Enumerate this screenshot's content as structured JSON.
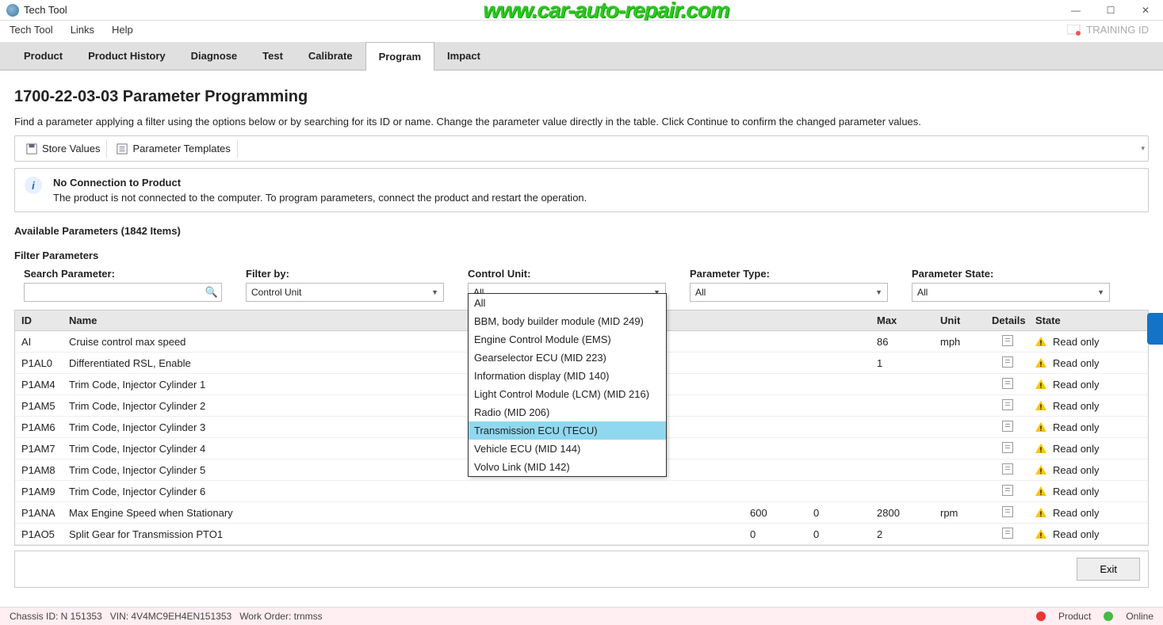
{
  "window": {
    "title": "Tech Tool"
  },
  "watermark": "www.car-auto-repair.com",
  "training_id": "TRAINING ID",
  "menubar": {
    "items": [
      "Tech Tool",
      "Links",
      "Help"
    ]
  },
  "tabs": {
    "items": [
      "Product",
      "Product History",
      "Diagnose",
      "Test",
      "Calibrate",
      "Program",
      "Impact"
    ],
    "active_index": 5
  },
  "page": {
    "title": "1700-22-03-03 Parameter Programming",
    "description": "Find a parameter applying a filter using the options below or by searching for its ID or name. Change the parameter value directly in the table. Click Continue to confirm the changed parameter values."
  },
  "toolbar": {
    "store_values": "Store Values",
    "templates": "Parameter Templates"
  },
  "infobox": {
    "title": "No Connection to Product",
    "text": "The product is not connected to the computer. To program parameters, connect the product and restart the operation."
  },
  "available_label": "Available Parameters (1842 Items)",
  "filter_label": "Filter Parameters",
  "filters": {
    "search_label": "Search Parameter:",
    "filterby_label": "Filter by:",
    "filterby_value": "Control Unit",
    "control_unit_label": "Control Unit:",
    "control_unit_value": "All",
    "param_type_label": "Parameter Type:",
    "param_type_value": "All",
    "param_state_label": "Parameter State:",
    "param_state_value": "All"
  },
  "control_unit_options": [
    "All",
    "BBM, body builder module (MID 249)",
    "Engine Control Module (EMS)",
    "Gearselector ECU (MID 223)",
    "Information display (MID 140)",
    "Light Control Module (LCM) (MID 216)",
    "Radio (MID 206)",
    "Transmission ECU (TECU)",
    "Vehicle ECU (MID 144)",
    "Volvo Link (MID 142)"
  ],
  "control_unit_highlight_index": 7,
  "columns": {
    "id": "ID",
    "name": "Name",
    "value": "",
    "min": "",
    "max": "Max",
    "unit": "Unit",
    "details": "Details",
    "state": "State"
  },
  "rows": [
    {
      "id": "AI",
      "name": "Cruise control max speed",
      "value": "",
      "min": "",
      "max": "86",
      "unit": "mph",
      "state": "Read only"
    },
    {
      "id": "P1AL0",
      "name": "Differentiated RSL, Enable",
      "value": "",
      "min": "",
      "max": "1",
      "unit": "",
      "state": "Read only"
    },
    {
      "id": "P1AM4",
      "name": "Trim Code, Injector Cylinder 1",
      "value": "",
      "min": "",
      "max": "",
      "unit": "",
      "state": "Read only"
    },
    {
      "id": "P1AM5",
      "name": "Trim Code, Injector Cylinder 2",
      "value": "",
      "min": "",
      "max": "",
      "unit": "",
      "state": "Read only"
    },
    {
      "id": "P1AM6",
      "name": "Trim Code, Injector Cylinder 3",
      "value": "",
      "min": "",
      "max": "",
      "unit": "",
      "state": "Read only"
    },
    {
      "id": "P1AM7",
      "name": "Trim Code, Injector Cylinder 4",
      "value": "",
      "min": "",
      "max": "",
      "unit": "",
      "state": "Read only"
    },
    {
      "id": "P1AM8",
      "name": "Trim Code, Injector Cylinder 5",
      "value": "",
      "min": "",
      "max": "",
      "unit": "",
      "state": "Read only"
    },
    {
      "id": "P1AM9",
      "name": "Trim Code, Injector Cylinder 6",
      "value": "",
      "min": "",
      "max": "",
      "unit": "",
      "state": "Read only"
    },
    {
      "id": "P1ANA",
      "name": "Max Engine Speed when Stationary",
      "value": "600",
      "min": "0",
      "max": "2800",
      "unit": "rpm",
      "state": "Read only"
    },
    {
      "id": "P1AO5",
      "name": "Split Gear for Transmission PTO1",
      "value": "0",
      "min": "0",
      "max": "2",
      "unit": "",
      "state": "Read only"
    }
  ],
  "exit_label": "Exit",
  "status": {
    "chassis": "Chassis ID: N 151353",
    "vin": "VIN: 4V4MC9EH4EN151353",
    "workorder": "Work Order: trnmss",
    "product_label": "Product",
    "online_label": "Online"
  }
}
